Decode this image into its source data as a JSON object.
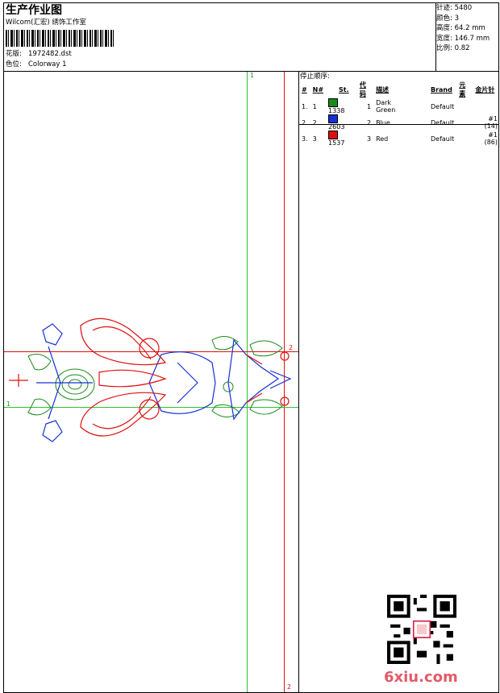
{
  "header": {
    "title": "生产作业图",
    "subtitle": "Wilcom(汇宏) 绣饰工作室",
    "design_label": "花版:",
    "design_value": "1972482.dst",
    "colorway_label": "色位:",
    "colorway_value": "Colorway 1"
  },
  "stats": [
    {
      "label": "针迹:",
      "value": "5480"
    },
    {
      "label": "颜色:",
      "value": "3"
    },
    {
      "label": "高度:",
      "value": "64.2 mm"
    },
    {
      "label": "宽度:",
      "value": "146.7 mm"
    },
    {
      "label": "比例:",
      "value": "0.82"
    }
  ],
  "stop_sequence": {
    "title": "停止顺序:",
    "headers": [
      "#",
      "N#",
      "St.",
      "代码",
      "描述",
      "Brand",
      "元素",
      "金片针"
    ],
    "rows": [
      {
        "num": "1.",
        "n": "1",
        "st": "1338",
        "code": "1",
        "desc": "Dark Green",
        "brand": "Default",
        "element": "",
        "sequin": "",
        "color": "#1a8a1a"
      },
      {
        "num": "2.",
        "n": "2",
        "st": "2603",
        "code": "2",
        "desc": "Blue",
        "brand": "Default",
        "element": "",
        "sequin": "#1 (14)",
        "color": "#1530d8"
      },
      {
        "num": "3.",
        "n": "3",
        "st": "1537",
        "code": "3",
        "desc": "Red",
        "brand": "Default",
        "element": "",
        "sequin": "#1 (86)",
        "color": "#e01010"
      }
    ]
  },
  "guides": {
    "v1_label": "1",
    "v2_label": "2",
    "h1_label": "1",
    "h2_label": "2"
  },
  "watermark": "6xiu.com"
}
